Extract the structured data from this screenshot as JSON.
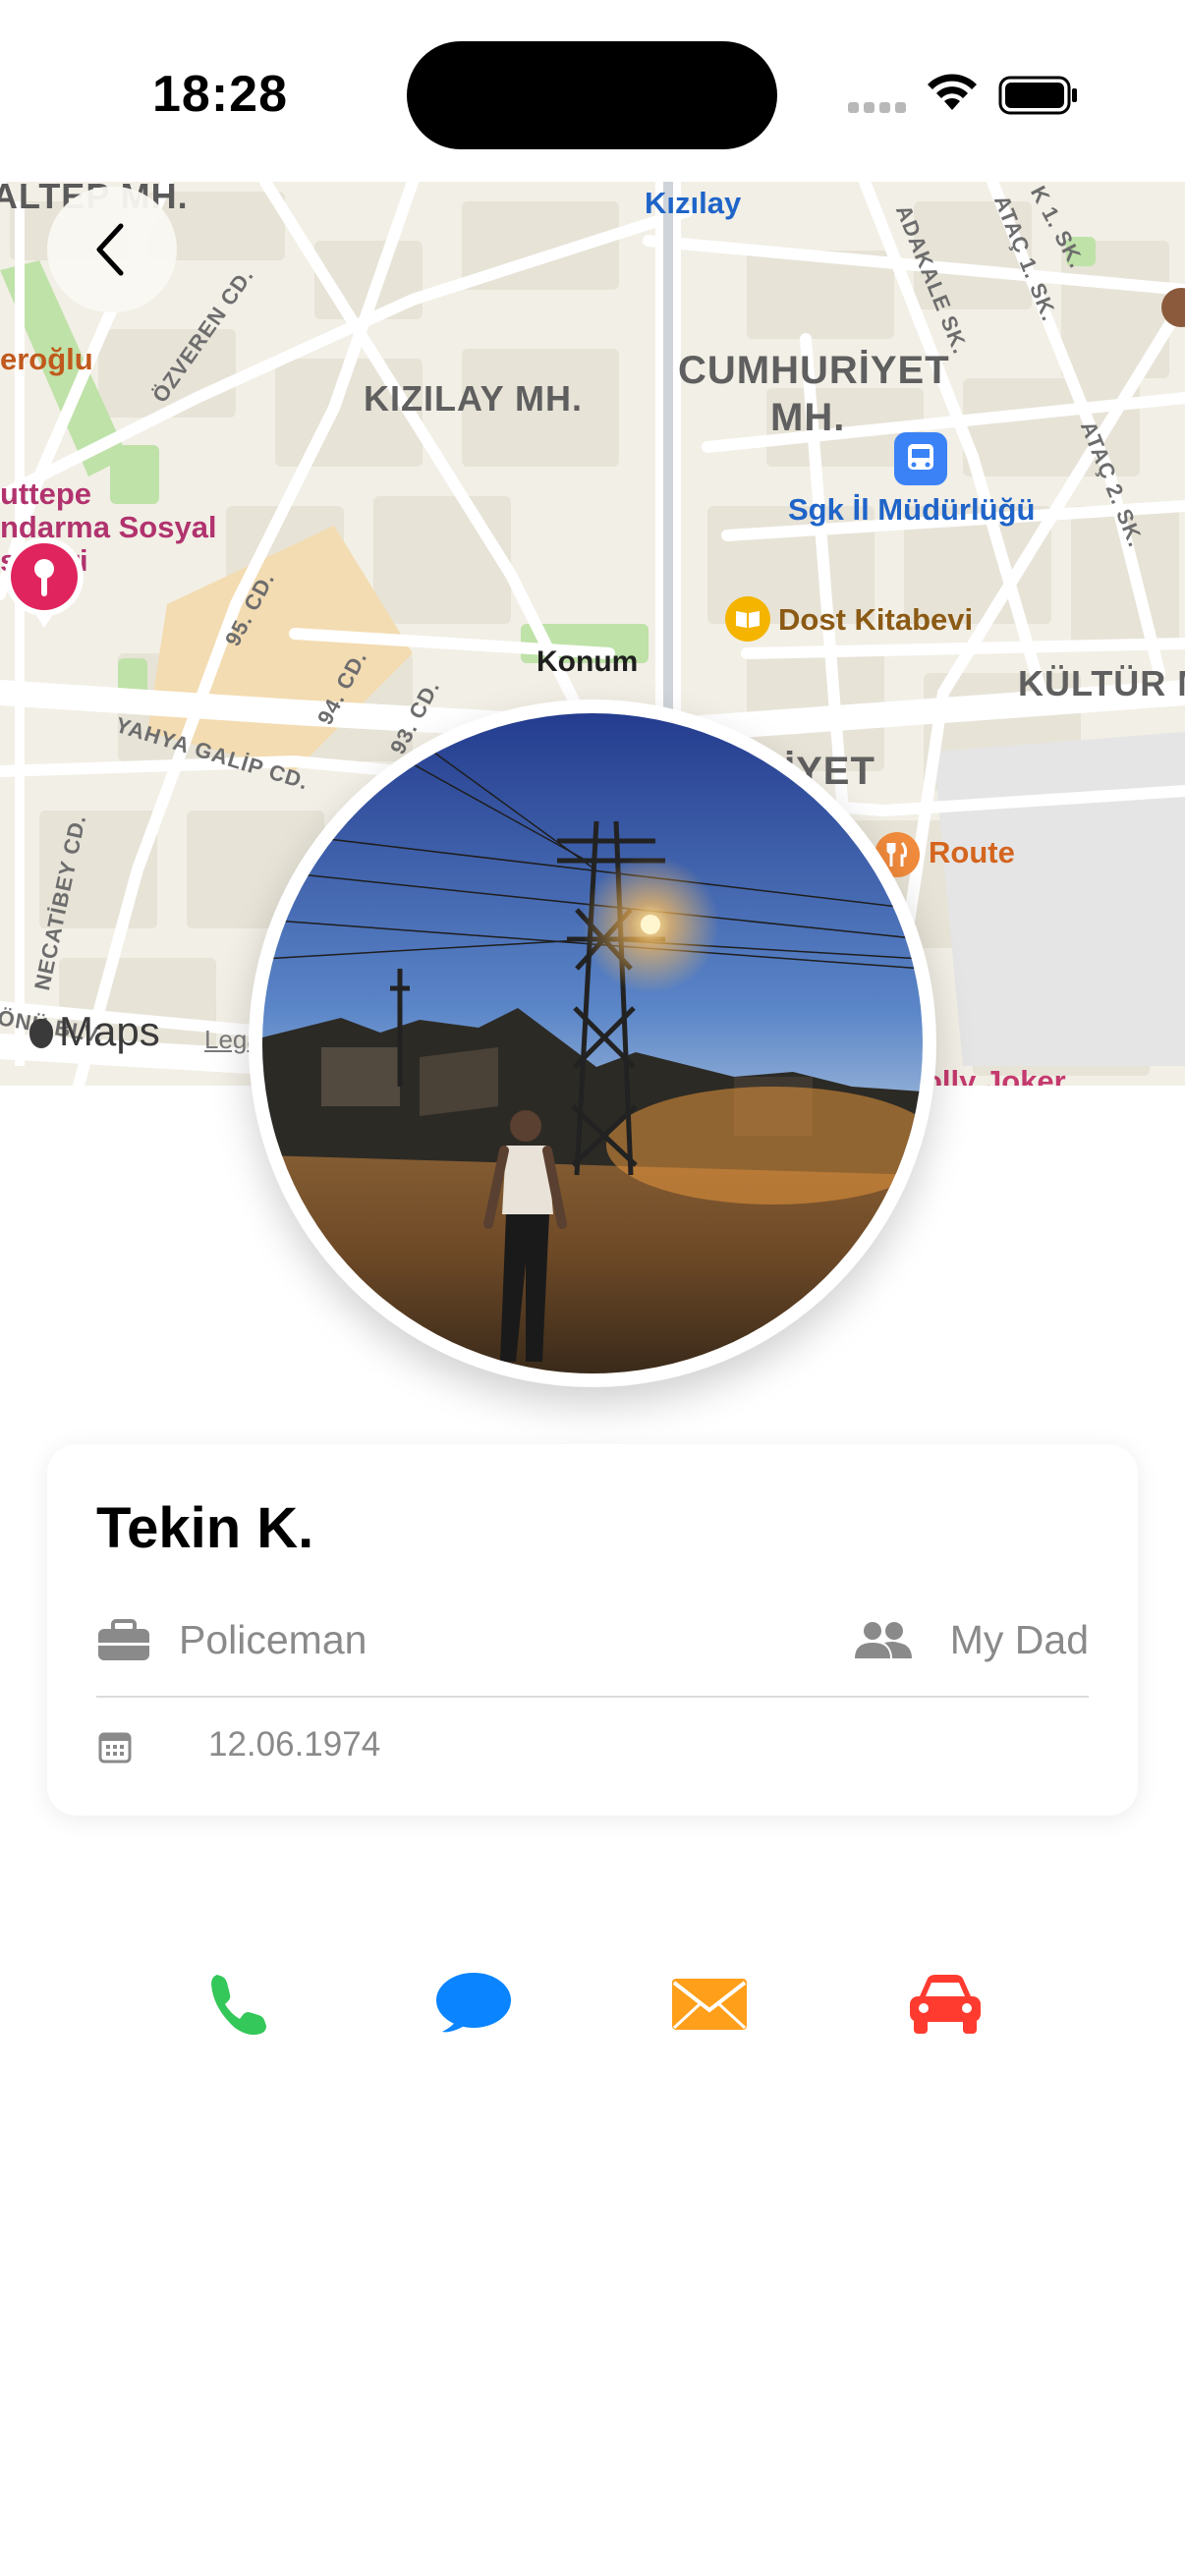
{
  "status_bar": {
    "time": "18:28"
  },
  "map": {
    "labels": {
      "kizilay_top": "Kızılay",
      "kizilay_mh": "KIZILAY MH.",
      "cumhuriyet_1": "CUMHURİYET",
      "cumhuriyet_2": "MH.",
      "sgk": "Sgk İl Müdürlüğü",
      "dost": "Dost Kitabevi",
      "kultur": "KÜLTÜR M",
      "iyet": "İYET",
      "route": "Route",
      "eroglu": "eroğlu",
      "uttepe": "uttepe",
      "andarma": "ndarma Sosyal",
      "isleri": "sisleri",
      "necatibey": "NECATİBEY CD.",
      "yahya": "YAHYA GALİP CD.",
      "cd95": "95. CD.",
      "cd94": "94. CD.",
      "cd93": "93. CD.",
      "ozveren": "ÖZVEREN CD.",
      "adakale": "ADAKALE SK.",
      "atac1": "ATAÇ 1. SK.",
      "atac2": "ATAÇ 2. SK.",
      "k1": "K 1. SK.",
      "blvd": "ÖNÜ BLV.",
      "joker": "olly Joker",
      "top_left": "ALTEP MH."
    },
    "pin_label": "Konum",
    "maps_brand": "Maps",
    "legal": "Legal"
  },
  "profile": {
    "name": "Tekin K.",
    "occupation": "Policeman",
    "relation": "My Dad",
    "birth_date": "12.06.1974"
  },
  "colors": {
    "call": "#34c759",
    "message": "#0a84ff",
    "mail": "#ff9f1a",
    "car": "#ff3b30",
    "pin": "#e0245e"
  },
  "actions": [
    "phone-icon",
    "message-bubble-icon",
    "envelope-icon",
    "car-icon"
  ]
}
